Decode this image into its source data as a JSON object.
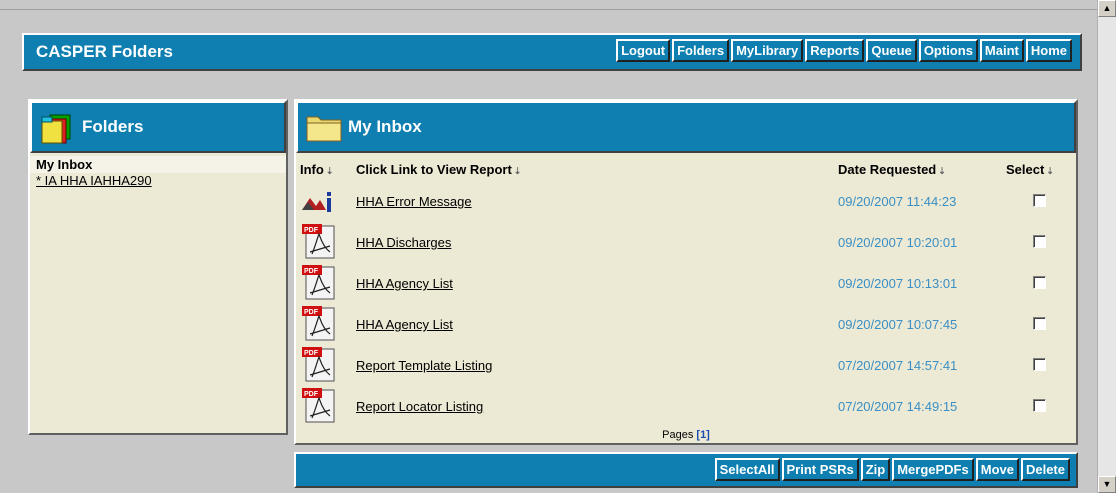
{
  "app": {
    "title": "CASPER Folders"
  },
  "nav": [
    "Logout",
    "Folders",
    "MyLibrary",
    "Reports",
    "Queue",
    "Options",
    "Maint",
    "Home"
  ],
  "folders": {
    "title": "Folders",
    "current": "My Inbox",
    "items": [
      "* IA HHA IAHHA290"
    ]
  },
  "inbox": {
    "title": "My Inbox",
    "columns": {
      "info": "Info",
      "report": "Click Link to View Report",
      "date": "Date Requested",
      "select": "Select"
    },
    "rows": [
      {
        "icon": "jpeg-icon",
        "name": "HHA Error Message",
        "date": "09/20/2007 11:44:23"
      },
      {
        "icon": "pdf-icon",
        "name": "HHA Discharges",
        "date": "09/20/2007 10:20:01"
      },
      {
        "icon": "pdf-icon",
        "name": "HHA Agency List",
        "date": "09/20/2007 10:13:01"
      },
      {
        "icon": "pdf-icon",
        "name": "HHA Agency List",
        "date": "09/20/2007 10:07:45"
      },
      {
        "icon": "pdf-icon",
        "name": "Report Template Listing",
        "date": "07/20/2007 14:57:41"
      },
      {
        "icon": "pdf-icon",
        "name": "Report Locator Listing",
        "date": "07/20/2007 14:49:15"
      }
    ],
    "pages_label": "Pages",
    "page": "[1]"
  },
  "actions": [
    "SelectAll",
    "Print PSRs",
    "Zip",
    "MergePDFs",
    "Move",
    "Delete"
  ],
  "colors": {
    "accent": "#0e7fb0",
    "panel_bg": "#ece9d5",
    "date_text": "#3a8fc4"
  }
}
